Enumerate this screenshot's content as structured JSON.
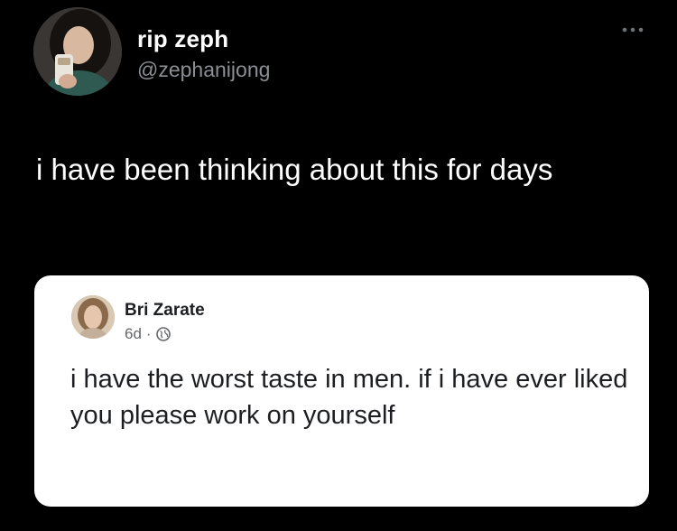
{
  "tweet": {
    "author": {
      "display_name": "rip zeph",
      "handle": "@zephanijong"
    },
    "text": "i have been thinking about this for days",
    "more_icon": "more-horizontal-icon"
  },
  "quoted_post": {
    "author": {
      "name": "Bri Zarate"
    },
    "time": "6d",
    "separator": "·",
    "visibility_icon": "globe-icon",
    "text": "i have the worst taste in men. if i have ever liked you please work on yourself"
  },
  "colors": {
    "background": "#000000",
    "primary_text": "#ffffff",
    "secondary_text": "#8b8f94",
    "card_background": "#ffffff",
    "card_text": "#1c1e21",
    "card_meta": "#65676b"
  }
}
